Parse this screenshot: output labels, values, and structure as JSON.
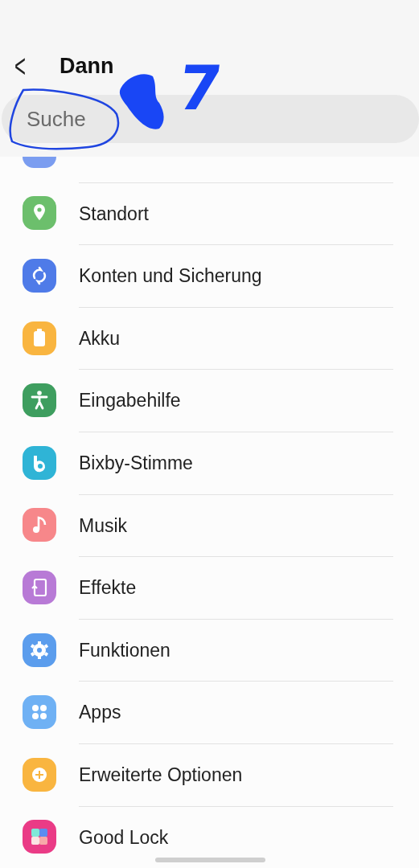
{
  "header": {
    "title": "Dann",
    "back_symbol": "<"
  },
  "search": {
    "placeholder": "Suche"
  },
  "annotation": {
    "text": "7"
  },
  "partial_item": {
    "color": "#7b9df0"
  },
  "items": [
    {
      "label": "Standort",
      "color": "#6cbf6c"
    },
    {
      "label": "Konten und Sicherung",
      "color": "#4f7be8"
    },
    {
      "label": "Akku",
      "color": "#f9b540"
    },
    {
      "label": "Eingabehilfe",
      "color": "#3e9e5f"
    },
    {
      "label": "Bixby-Stimme",
      "color": "#2fb4d6"
    },
    {
      "label": "Musik",
      "color": "#f7878a"
    },
    {
      "label": "Effekte",
      "color": "#b87ad6"
    },
    {
      "label": "Funktionen",
      "color": "#5b9ded"
    },
    {
      "label": "Apps",
      "color": "#6fb1f4"
    },
    {
      "label": "Erweiterte Optionen",
      "color": "#f9b540"
    },
    {
      "label": "Good Lock",
      "color": "#ea3b86"
    }
  ]
}
